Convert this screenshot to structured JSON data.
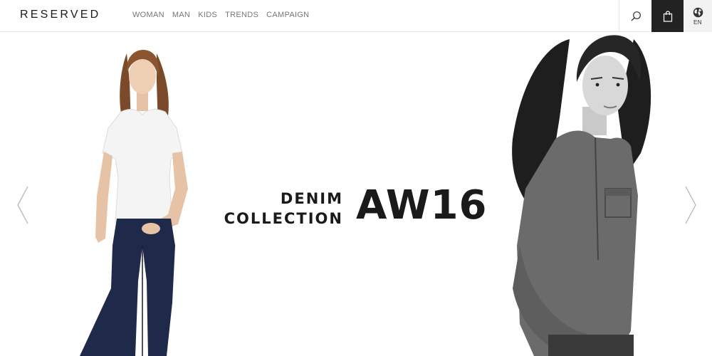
{
  "header": {
    "logo": "RESERVED",
    "nav": [
      {
        "label": "WOMAN"
      },
      {
        "label": "MAN"
      },
      {
        "label": "KIDS"
      },
      {
        "label": "TRENDS"
      },
      {
        "label": "CAMPAIGN"
      }
    ],
    "search_icon": "search-icon",
    "cart_icon": "shopping-bag-icon",
    "language": {
      "icon": "globe-icon",
      "label": "EN"
    }
  },
  "hero": {
    "line1": "DENIM",
    "line2": "COLLECTION",
    "big": "AW16",
    "prev_icon": "chevron-left-icon",
    "next_icon": "chevron-right-icon"
  },
  "colors": {
    "text_dark": "#1a1a1a",
    "nav_text": "#777777",
    "cart_bg": "#222222",
    "lang_bg": "#f2f2f2",
    "denim_blue": "#1f2a4a"
  }
}
